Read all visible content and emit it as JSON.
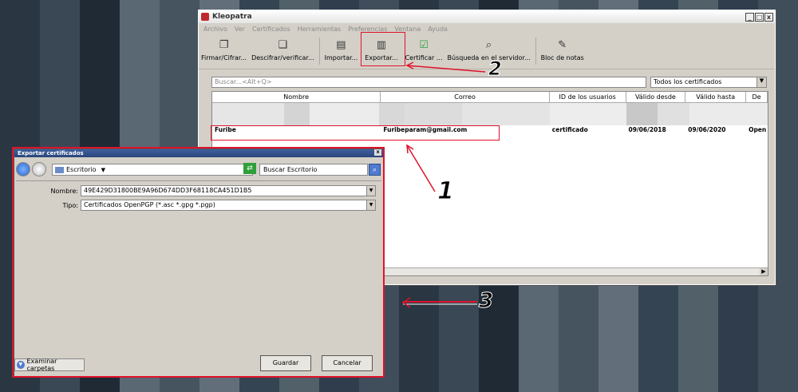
{
  "window": {
    "title": "Kleopatra",
    "controls": [
      "_",
      "□",
      "x"
    ],
    "menu": [
      "Archivo",
      "Ver",
      "Certificados",
      "Herramientas",
      "Preferencias",
      "Ventana",
      "Ayuda"
    ],
    "toolbar": [
      {
        "label": "Firmar/Cifrar...",
        "icon": "sign-encrypt-icon"
      },
      {
        "label": "Descifrar/verificar...",
        "icon": "decrypt-verify-icon"
      },
      {
        "label": "Importar...",
        "icon": "import-icon"
      },
      {
        "label": "Exportar...",
        "icon": "export-icon"
      },
      {
        "label": "Certificar ...",
        "icon": "certify-icon"
      },
      {
        "label": "Búsqueda en el servidor...",
        "icon": "search-icon"
      },
      {
        "label": "Bloc de notas",
        "icon": "pencil-icon"
      }
    ],
    "search_placeholder": "Buscar...<Alt+Q>",
    "filter_value": "Todos los certificados",
    "columns": [
      "Nombre",
      "Correo",
      "ID de los usuarios",
      "Válido desde",
      "Válido hasta",
      "De"
    ],
    "row": {
      "name": "Furibe",
      "email": "Furibeparam@gmail.com",
      "user_id": "certificado",
      "valid_from": "09/06/2018",
      "valid_to": "09/06/2020",
      "detail": "Open"
    }
  },
  "dialog": {
    "title": "Exportar certificados",
    "close": "x",
    "location": "Escritorio",
    "search_placeholder": "Buscar Escritorio",
    "name_label": "Nombre:",
    "name_value": "49E429D31800BE9A96D674DD3F68118CA451D1B5",
    "type_label": "Tipo:",
    "type_value": "Certificados OpenPGP (*.asc *.gpg *.pgp)",
    "browse_label": "Examinar carpetas",
    "save_label": "Guardar",
    "cancel_label": "Cancelar"
  },
  "annotations": {
    "one": "1",
    "two": "2",
    "three": "3",
    "color": "#e0122a"
  }
}
